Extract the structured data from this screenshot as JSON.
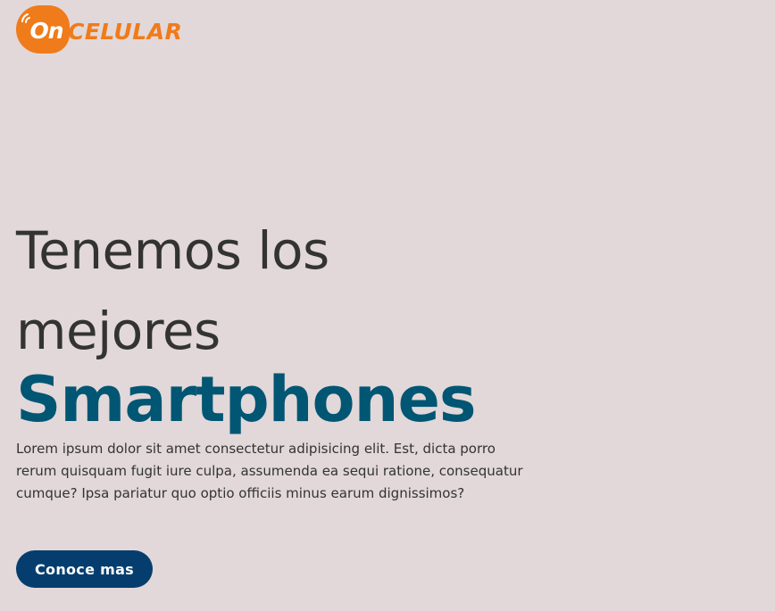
{
  "logo": {
    "badge_text": "On",
    "word": "CELULAR",
    "brand_color": "#f07b1a",
    "icon": "signal-waves-icon"
  },
  "hero": {
    "line1": "Tenemos los",
    "line2": "mejores",
    "highlight": "Smartphones",
    "highlight_color": "#015673",
    "body": "Lorem ipsum dolor sit amet consectetur adipisicing elit. Est, dicta porro rerum quisquam fugit iure culpa, assumenda ea sequi ratione, consequatur cumque? Ipsa pariatur quo optio officiis minus earum dignissimos?"
  },
  "cta": {
    "label": "Conoce mas",
    "color": "#053e6e"
  },
  "background_color": "#e2d8d9"
}
